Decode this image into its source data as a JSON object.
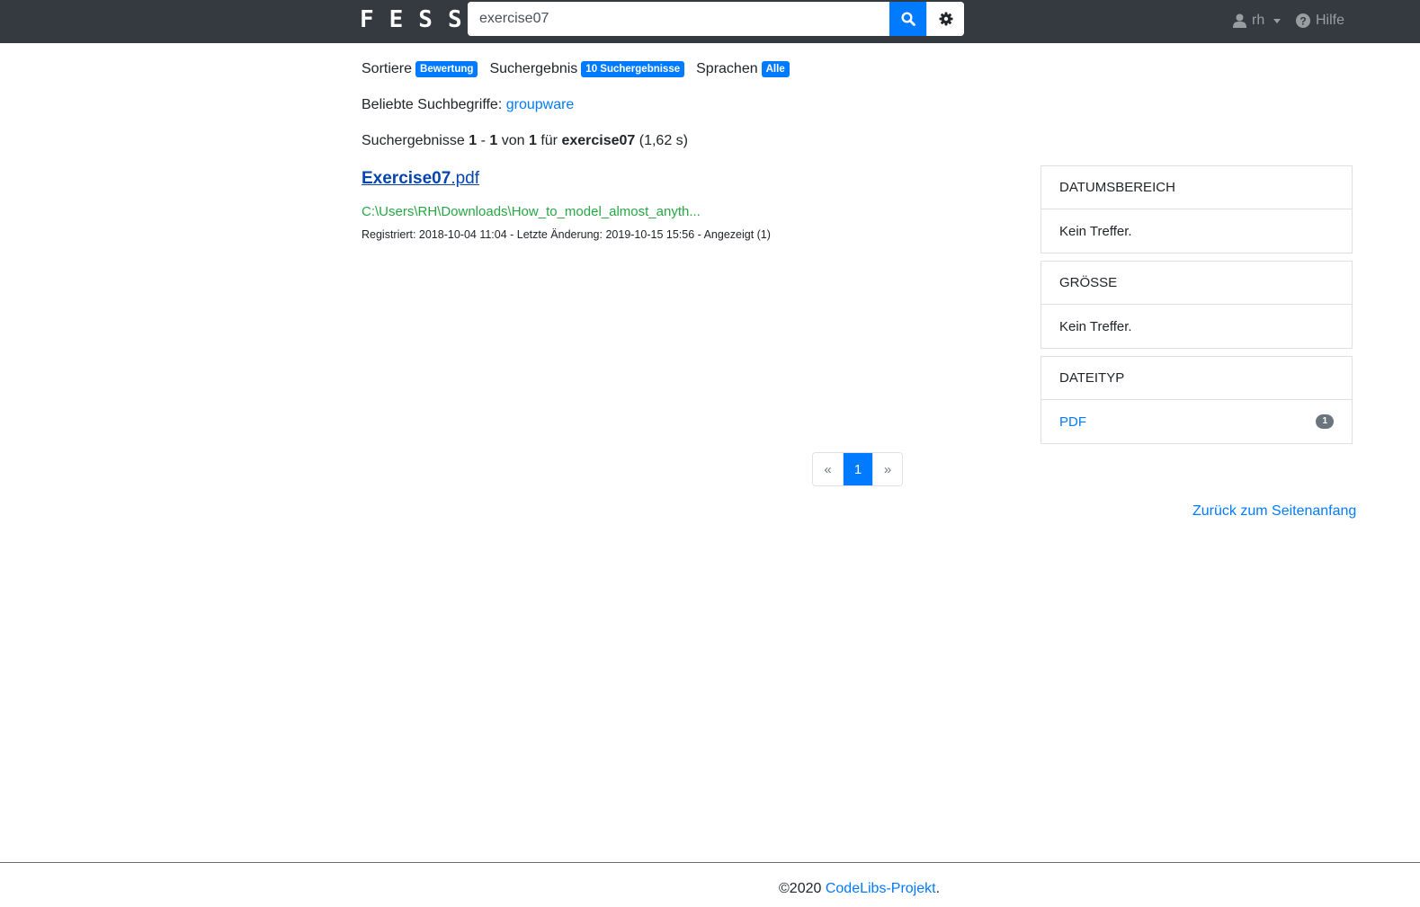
{
  "navbar": {
    "logo": "FESS",
    "search_value": "exercise07",
    "user_label": "rh",
    "help_label": "Hilfe"
  },
  "filters": {
    "sort_label": "Sortiere",
    "sort_value": "Bewertung",
    "results_label": "Suchergebnis",
    "results_value": "10 Suchergebnisse",
    "lang_label": "Sprachen",
    "lang_value": "Alle"
  },
  "popular": {
    "label": "Beliebte Suchbegriffe:",
    "term": "groupware"
  },
  "summary": {
    "prefix": "Suchergebnisse",
    "start": "1",
    "dash": "-",
    "end": "1",
    "of": "von",
    "total": "1",
    "for": "für",
    "query": "exercise07",
    "time": "(1,62 s)"
  },
  "result": {
    "title_bold": "Exercise07",
    "title_rest": ".pdf",
    "url": "C:\\Users\\RH\\Downloads\\How_to_model_almost_anyth...",
    "meta": "Registriert: 2018-10-04 11:04 - Letzte Änderung: 2019-10-15 15:56 - Angezeigt (1)"
  },
  "facets": {
    "date": {
      "title": "DATUMSBEREICH",
      "body": "Kein Treffer."
    },
    "size": {
      "title": "GRÖSSE",
      "body": "Kein Treffer."
    },
    "type": {
      "title": "DATEITYP",
      "item": "PDF",
      "count": "1"
    }
  },
  "pagination": {
    "prev": "«",
    "current": "1",
    "next": "»"
  },
  "back_to_top": "Zurück zum Seitenanfang",
  "footer": {
    "copyright": "©2020",
    "link": "CodeLibs-Projekt",
    "suffix": "."
  },
  "colors": {
    "navbar": "#343a40",
    "accent": "#007bff",
    "url_green": "#28a745"
  }
}
